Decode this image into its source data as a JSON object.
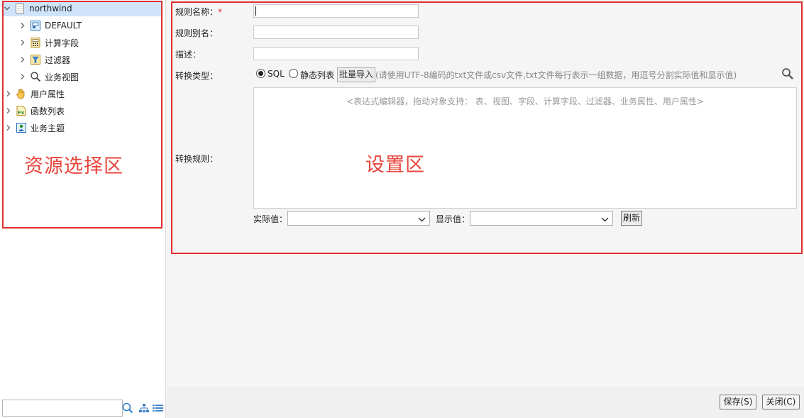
{
  "tree": {
    "root": {
      "label": "northwind",
      "icon": "database-icon",
      "expanded": true,
      "selected": true
    },
    "children": [
      {
        "label": "DEFAULT",
        "icon": "schema-icon"
      },
      {
        "label": "计算字段",
        "icon": "calc-field-icon"
      },
      {
        "label": "过滤器",
        "icon": "filter-icon"
      },
      {
        "label": "业务视图",
        "icon": "magnifier-icon"
      }
    ],
    "top_items": [
      {
        "label": "用户属性",
        "icon": "hand-icon"
      },
      {
        "label": "函数列表",
        "icon": "function-icon"
      },
      {
        "label": "业务主题",
        "icon": "subject-icon"
      }
    ]
  },
  "annotations": {
    "left_zone": "资源选择区",
    "right_zone": "设置区"
  },
  "form": {
    "rule_name_label": "规则名称：",
    "required_mark": "*",
    "rule_name_value": "",
    "rule_alias_label": "规则别名：",
    "rule_alias_value": "",
    "description_label": "描述：",
    "description_value": "",
    "convert_type_label": "转换类型：",
    "radio_sql": "SQL",
    "radio_static": "静态列表",
    "radio_selected": "SQL",
    "import_button": "批量导入",
    "import_hint": "(请使用UTF-8编码的txt文件或csv文件,txt文件每行表示一组数据，用逗号分割实际值和显示值)",
    "convert_rule_label": "转换规则：",
    "editor_placeholder": "<表达式编辑器，拖动对象支持： 表、视图、字段、计算字段、过滤器、业务属性、用户属性>",
    "actual_value_label": "实际值：",
    "actual_value": "",
    "display_value_label": "显示值：",
    "display_value": "",
    "refresh_button": "刷新"
  },
  "footer": {
    "save_button": "保存(S)",
    "close_button": "关闭(C)"
  },
  "colors": {
    "annotation_red": "#e03030",
    "selection": "#cfe4fa"
  }
}
